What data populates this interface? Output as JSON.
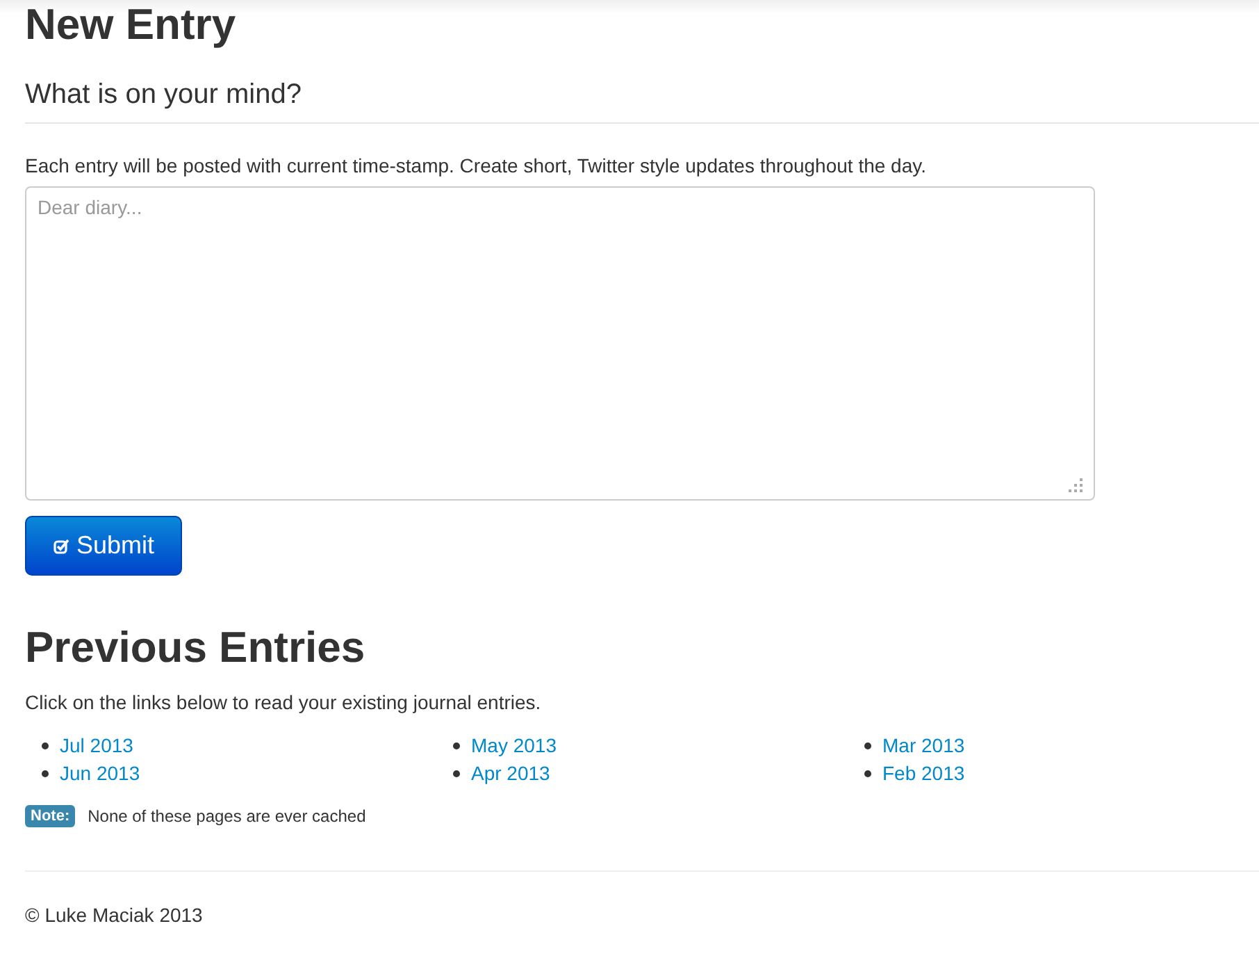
{
  "page_title": "New Entry",
  "form": {
    "heading": "What is on your mind?",
    "help": "Each entry will be posted with current time-stamp. Create short, Twitter style updates throughout the day.",
    "placeholder": "Dear diary...",
    "submit": "Submit"
  },
  "previous": {
    "heading": "Previous Entries",
    "intro": "Click on the links below to read your existing journal entries.",
    "columns": [
      {
        "links": [
          "Jul 2013",
          "Jun 2013"
        ]
      },
      {
        "links": [
          "May 2013",
          "Apr 2013"
        ]
      },
      {
        "links": [
          "Mar 2013",
          "Feb 2013"
        ]
      }
    ],
    "note": {
      "label": "Note:",
      "text": "None of these pages are ever cached"
    }
  },
  "footer": "© Luke Maciak 2013"
}
